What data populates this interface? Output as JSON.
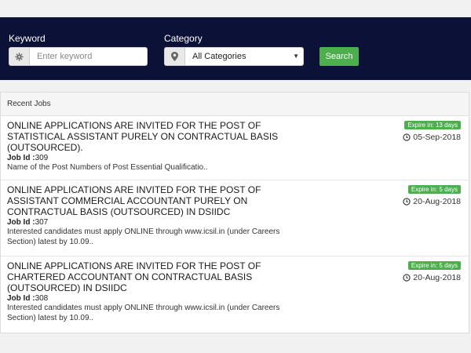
{
  "search": {
    "keyword_label": "Keyword",
    "keyword_placeholder": "Enter keyword",
    "keyword_icon": "gear-icon",
    "category_label": "Category",
    "category_value": "All Categories",
    "category_icon": "map-marker-icon",
    "search_button": "Search"
  },
  "colors": {
    "panel_bg": "#0b1137",
    "button_green": "#4cae4c"
  },
  "recent_jobs": {
    "heading": "Recent Jobs",
    "id_label": "Job Id :",
    "jobs": [
      {
        "title": "ONLINE APPLICATIONS ARE INVITED FOR THE POST OF STATISTICAL ASSISTANT PURELY ON CONTRACTUAL BASIS (OUTSOURCED).",
        "id": "309",
        "description": "Name of the Post Numbers of Post Essential Qualificatio..",
        "expire": "Expire in:  13 days",
        "date": "05-Sep-2018"
      },
      {
        "title": "ONLINE APPLICATIONS ARE INVITED FOR THE POST OF ASSISTANT COMMERCIAL ACCOUNTANT PURELY ON CONTRACTUAL BASIS (OUTSOURCED) IN DSIIDC",
        "id": "307",
        "description": "Interested candidates must apply ONLINE through www.icsil.in (under Careers Section) latest by 10.09..",
        "expire": "Expire in:  5 days",
        "date": "20-Aug-2018"
      },
      {
        "title": "ONLINE APPLICATIONS ARE INVITED FOR THE POST OF CHARTERED ACCOUNTANT ON CONTRACTUAL BASIS (OUTSOURCED) IN DSIIDC",
        "id": "308",
        "description": "Interested candidates must apply ONLINE through www.icsil.in (under Careers Section) latest by 10.09..",
        "expire": "Expire in:  5 days",
        "date": "20-Aug-2018"
      }
    ]
  }
}
